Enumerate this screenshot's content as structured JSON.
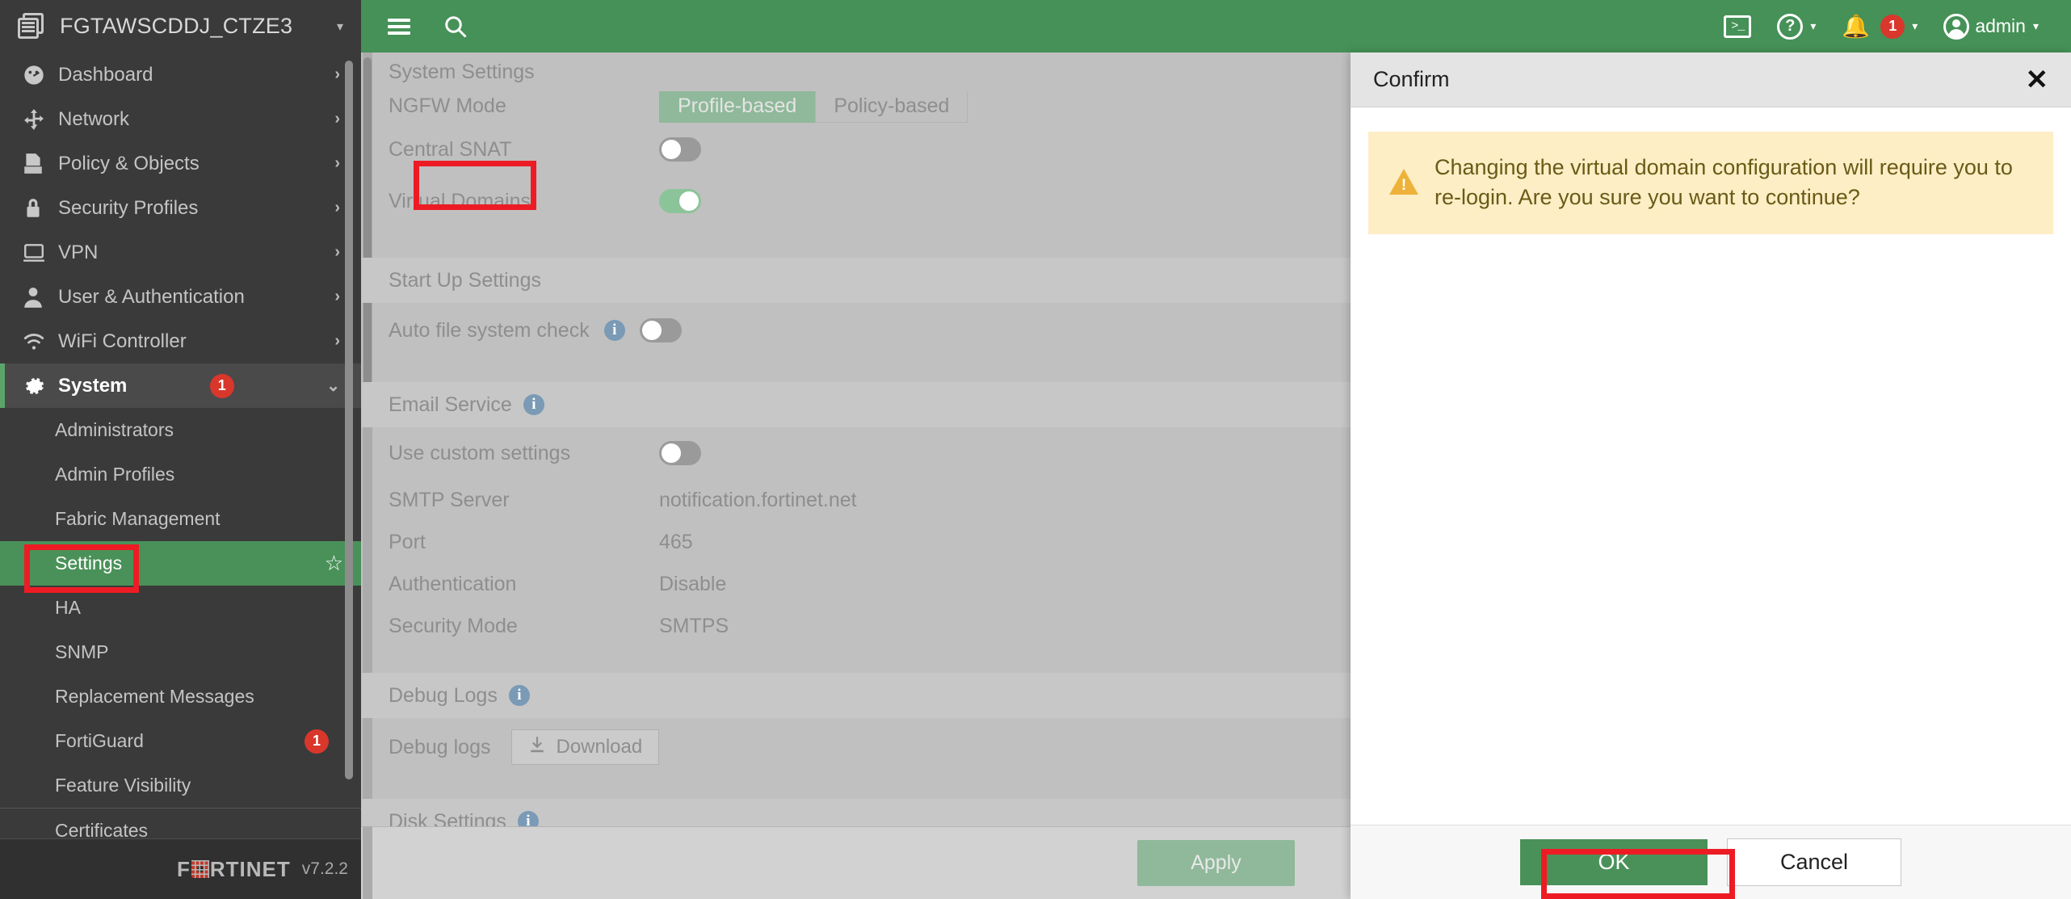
{
  "device": {
    "name": "FGTAWSCDDJ_CTZE3",
    "icon": "device-stack-icon",
    "caret": "▾"
  },
  "topbar": {
    "menu_icon": "hamburger-icon",
    "search_icon": "search-icon",
    "cli_label": ">_",
    "cli_icon": "cli-console-icon",
    "help_icon": "help-icon",
    "help_caret": "▾",
    "notification_icon": "bell-icon",
    "notification_count": "1",
    "notification_caret": "▾",
    "user_icon": "user-avatar-icon",
    "user_label": "admin",
    "user_caret": "▾"
  },
  "sidebar": {
    "items": [
      {
        "label": "Dashboard",
        "icon": "dashboard-gauge-icon",
        "glyph": "◔",
        "chevron": "›"
      },
      {
        "label": "Network",
        "icon": "network-arrows-icon",
        "glyph": "✥",
        "chevron": "›"
      },
      {
        "label": "Policy & Objects",
        "icon": "policy-document-icon",
        "glyph": "὜b",
        "chevron": "›"
      },
      {
        "label": "Security Profiles",
        "icon": "lock-icon",
        "glyph": "ὑ2",
        "chevron": "›"
      },
      {
        "label": "VPN",
        "icon": "monitor-icon",
        "glyph": "Ὓ5",
        "chevron": "›"
      },
      {
        "label": "User & Authentication",
        "icon": "user-icon",
        "glyph": "὆4",
        "chevron": "›"
      },
      {
        "label": "WiFi Controller",
        "icon": "wifi-icon",
        "glyph": "὏6",
        "chevron": "›"
      },
      {
        "label": "System",
        "icon": "gear-icon",
        "glyph": "⚙",
        "chevron": "⌄",
        "badge": "1",
        "active": true
      }
    ],
    "system_submenu": [
      {
        "label": "Administrators"
      },
      {
        "label": "Admin Profiles"
      },
      {
        "label": "Fabric Management"
      },
      {
        "label": "Settings",
        "selected": true,
        "star_icon": "favorite-star-icon",
        "star": "☆"
      },
      {
        "label": "HA"
      },
      {
        "label": "SNMP"
      },
      {
        "label": "Replacement Messages"
      },
      {
        "label": "FortiGuard",
        "badge": "1"
      },
      {
        "label": "Feature Visibility"
      },
      {
        "label": "Certificates",
        "divider_above": true
      }
    ],
    "footer": {
      "brand": "FORTINET",
      "brand_prefix": "F",
      "brand_suffix": "RTINET",
      "version": "v7.2.2"
    }
  },
  "main": {
    "heading": "System Settings",
    "ngfw": {
      "label": "NGFW Mode",
      "options": [
        "Profile-based",
        "Policy-based"
      ],
      "selected": "Profile-based"
    },
    "central_snat": {
      "label": "Central SNAT",
      "state": "off"
    },
    "virtual_domains": {
      "label": "Virtual Domains",
      "state": "on"
    },
    "startup": {
      "heading": "Start Up Settings",
      "auto_fsck": {
        "label": "Auto file system check",
        "state": "off",
        "info_icon": "info-icon"
      }
    },
    "email_service": {
      "heading": "Email Service",
      "info_icon": "info-icon",
      "use_custom": {
        "label": "Use custom settings",
        "state": "off"
      },
      "fields": [
        {
          "label": "SMTP Server",
          "value": "notification.fortinet.net"
        },
        {
          "label": "Port",
          "value": "465"
        },
        {
          "label": "Authentication",
          "value": "Disable"
        },
        {
          "label": "Security Mode",
          "value": "SMTPS"
        }
      ]
    },
    "debug_logs": {
      "heading": "Debug Logs",
      "info_icon": "info-icon",
      "row_label": "Debug logs",
      "download_label": "Download",
      "download_icon": "download-icon"
    },
    "disk_settings": {
      "heading": "Disk Settings",
      "info_icon": "info-icon"
    },
    "apply_label": "Apply"
  },
  "dialog": {
    "title": "Confirm",
    "close_icon": "close-icon",
    "close_glyph": "✕",
    "warning_icon": "warning-triangle-icon",
    "message": "Changing the virtual domain configuration will require you to re-login. Are you sure you want to continue?",
    "ok_label": "OK",
    "cancel_label": "Cancel"
  },
  "colors": {
    "brand_green": "#459157",
    "accent_green": "#4a9159",
    "annotation_red": "#ed1c24",
    "sidebar_dark": "#3a3a3a",
    "warning_bg": "#fdeec5"
  }
}
